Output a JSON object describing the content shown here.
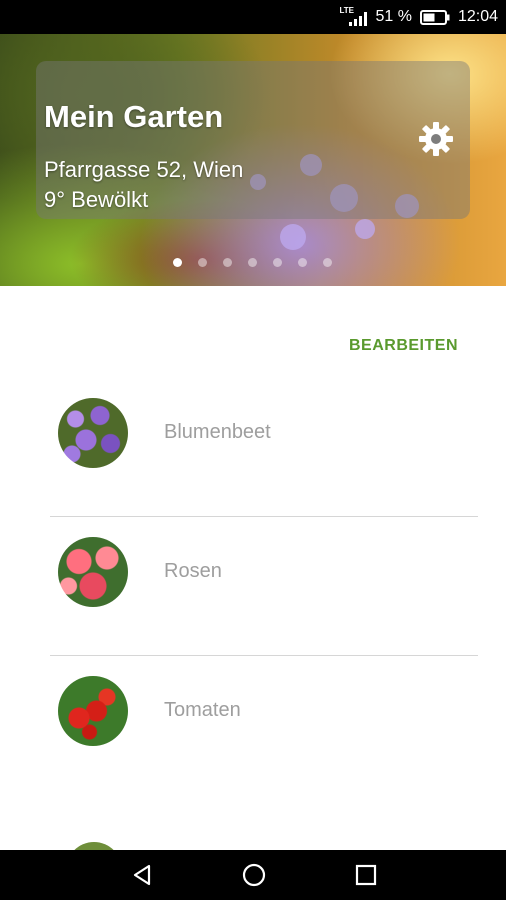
{
  "status_bar": {
    "network": "LTE",
    "battery": "51 %",
    "time": "12:04"
  },
  "header": {
    "title": "Mein Garten",
    "address": "Pfarrgasse 52, Wien",
    "weather": "9° Bewölkt",
    "settings_icon": "gear-icon",
    "pager": {
      "total": 7,
      "active_index": 0
    }
  },
  "actions": {
    "edit_label": "BEARBEITEN"
  },
  "beds": [
    {
      "label": "Blumenbeet",
      "icon": "flower-bed-thumbnail"
    },
    {
      "label": "Rosen",
      "icon": "roses-thumbnail"
    },
    {
      "label": "Tomaten",
      "icon": "tomatoes-thumbnail"
    }
  ],
  "nav": {
    "back_icon": "back-icon",
    "home_icon": "home-icon",
    "recents_icon": "recents-icon"
  },
  "colors": {
    "accent": "#5a9a2e",
    "label_gray": "#9e9e9e",
    "divider": "#d6d6d6"
  }
}
